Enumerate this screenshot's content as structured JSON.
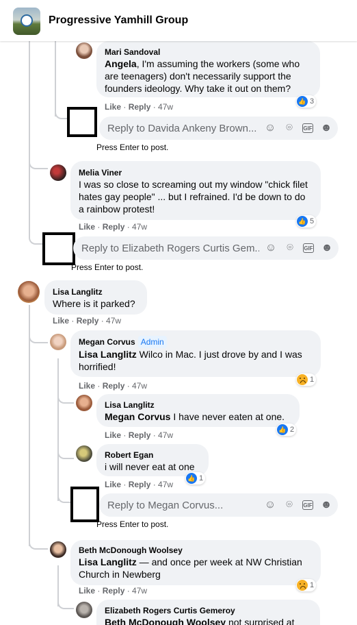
{
  "group": {
    "name": "Progressive Yamhill Group"
  },
  "actions": {
    "like": "Like",
    "reply": "Reply",
    "dot": "·"
  },
  "reply_inputs": [
    {
      "placeholder": "Reply to Davida Ankeny Brown...",
      "hint": "Press Enter to post."
    },
    {
      "placeholder": "Reply to Elizabeth Rogers Curtis Gem...",
      "hint": "Press Enter to post."
    },
    {
      "placeholder": "Reply to Megan Corvus...",
      "hint": "Press Enter to post."
    }
  ],
  "comments": [
    {
      "name": "Mari Sandoval",
      "mention": "Angela",
      "text": ", I'm assuming the workers (some who are teenagers) don't necessarily support the founders ideology. Why take it out on them?",
      "time": "47w",
      "reaction": "like",
      "count": "3"
    },
    {
      "name": "Melia Viner",
      "mention": "",
      "text": "I was so close to screaming out my window \"chick filet hates gay people\" ... but I refrained. I'd be down to do a rainbow protest!",
      "time": "47w",
      "reaction": "like",
      "count": "5"
    },
    {
      "name": "Lisa Langlitz",
      "mention": "",
      "text": "Where is it parked?",
      "time": "47w",
      "reaction": "",
      "count": ""
    },
    {
      "name": "Megan Corvus",
      "badge": "Admin",
      "mention": "Lisa Langlitz",
      "text": " Wilco in Mac. I just drove by and I was horrified!",
      "time": "47w",
      "reaction": "sad",
      "count": "1"
    },
    {
      "name": "Lisa Langlitz",
      "mention": "Megan Corvus",
      "text": " I have never eaten at one.",
      "time": "47w",
      "reaction": "like",
      "count": "2"
    },
    {
      "name": "Robert Egan",
      "mention": "",
      "text": "i will never eat at one",
      "time": "47w",
      "reaction": "like",
      "count": "1"
    },
    {
      "name": "Beth McDonough Woolsey",
      "mention": "Lisa Langlitz",
      "text": " — and once per week at NW Christian Church in Newberg",
      "time": "47w",
      "reaction": "sad",
      "count": "1"
    },
    {
      "name": "Elizabeth Rogers Curtis Gemeroy",
      "mention": "Beth McDonough Woolsey",
      "text": " not surprised at",
      "time": "",
      "reaction": "",
      "count": ""
    }
  ],
  "icons": [
    "emoji-icon",
    "camera-icon",
    "gif-icon",
    "sticker-icon"
  ],
  "colors": {
    "bubble": "#f0f2f5",
    "like_blue": "#1877f2",
    "muted": "#65676b",
    "sad_yellow": "#f7b125"
  }
}
